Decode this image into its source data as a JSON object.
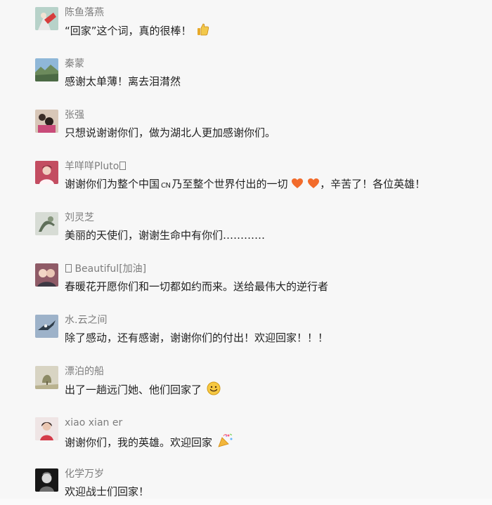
{
  "comments": [
    {
      "name": "陈鱼落燕",
      "text": "“回家”这个词，真的很棒！"
    },
    {
      "name": "秦蒙",
      "text": "感谢太单薄！离去泪潸然"
    },
    {
      "name": "张强",
      "text": "只想说谢谢你们，做为湖北人更加感谢你们。"
    },
    {
      "name": "羊咩咩Pluto",
      "text_before": "谢谢你们为整个中国",
      "cn_badge": "CN",
      "text_after": "乃至整个世界付出的一切",
      "text_end": "，辛苦了！各位英雄！"
    },
    {
      "name": "刘灵芝",
      "text": "美丽的天使们，谢谢生命中有你们…………"
    },
    {
      "name": "Beautiful[加油]",
      "text": "春暖花开愿你们和一切都如约而来。送给最伟大的逆行者"
    },
    {
      "name": "水.云之间",
      "text": "除了感动，还有感谢，谢谢你们的付出！欢迎回家！！！"
    },
    {
      "name": "漂泊的船",
      "text": "出了一趟远门她、他们回家了"
    },
    {
      "name": "xiao xian er",
      "text": "谢谢你们，我的英雄。欢迎回家"
    },
    {
      "name": "化学万岁",
      "text": "欢迎战士们回家！"
    }
  ],
  "icons": {
    "thumbs_up": "thumbs-up-icon",
    "heart": "heart-icon",
    "smile": "smile-icon",
    "party": "party-popper-icon",
    "placeholder_glyph": "missing-glyph-icon"
  },
  "colors": {
    "background": "#f7f7f7",
    "nickname": "#7d7d7d",
    "text": "#222222",
    "heart": "#f26b2b"
  }
}
